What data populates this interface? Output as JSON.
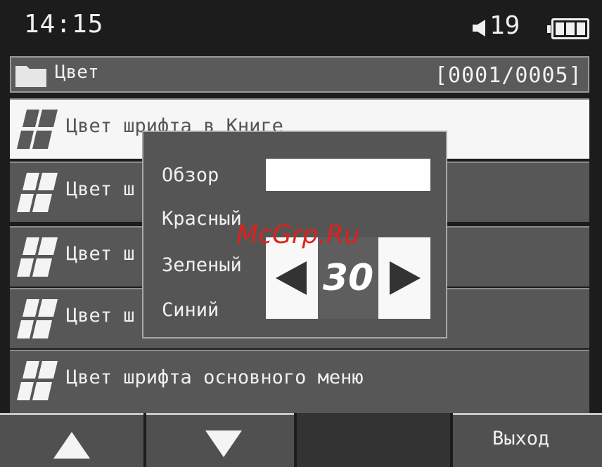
{
  "status": {
    "time": "14:15",
    "volume": "19",
    "volume_icon": "speaker-icon",
    "battery_icon": "battery-icon"
  },
  "header": {
    "title": "Цвет",
    "counter": "[0001/0005]",
    "icon": "folder-icon"
  },
  "list": {
    "items": [
      {
        "label": "Цвет шрифта в Книге",
        "selected": true
      },
      {
        "label": "Цвет ш"
      },
      {
        "label": "Цвет ш"
      },
      {
        "label": "Цвет ш"
      },
      {
        "label": "Цвет шрифта основного меню"
      }
    ]
  },
  "popup": {
    "preview_label": "Обзор",
    "red_label": "Красный",
    "green_label": "Зеленый",
    "blue_label": "Синий",
    "value": "30"
  },
  "watermark": "McGrp.Ru",
  "softkeys": {
    "up_icon": "arrow-up-icon",
    "down_icon": "arrow-down-icon",
    "exit_label": "Выход"
  },
  "colors": {
    "background": "#1c1c1c",
    "row": "#575757",
    "selected_row": "#f6f6f6",
    "watermark": "#e0201b"
  }
}
